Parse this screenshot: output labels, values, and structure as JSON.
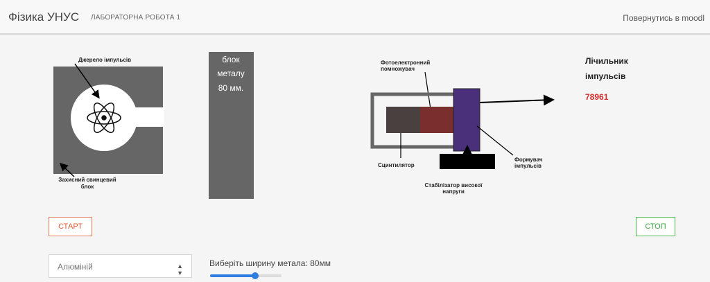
{
  "header": {
    "brand": "Фізика УНУС",
    "subtitle": "ЛАБОРАТОРНА РОБОТА 1",
    "back_link": "Повернутись в moodl"
  },
  "source": {
    "label": "Джерело імпульсів",
    "shield_label_line1": "Захисний свинцевий",
    "shield_label_line2": "блок",
    "icon": "atom-icon"
  },
  "metal_block": {
    "line1": "блок",
    "line2": "металу",
    "line3": "80 мм."
  },
  "detector": {
    "pmt_line1": "Фотоелектронний",
    "pmt_line2": "помножувач",
    "scintillator": "Сцинтилятор",
    "stabilizer_line1": "Стабілізатор високої",
    "stabilizer_line2": "напруги",
    "shaper_line1": "Формувач",
    "shaper_line2": "імпульсів"
  },
  "counter": {
    "title_line1": "Лічильник",
    "title_line2": "імпульсів",
    "value": "78961"
  },
  "controls": {
    "start_label": "СТАРТ",
    "stop_label": "СТОП",
    "material_selected": "Алюміній",
    "width_label": "Виберіть ширину метала: 80мм",
    "width_fraction": 0.63
  },
  "colors": {
    "start": "#e05a33",
    "stop": "#3aa23f",
    "counter_value": "#d32f2f",
    "slider": "#2f7de1",
    "pmt": "#7a2e2e",
    "shaper": "#4a2f7a"
  }
}
